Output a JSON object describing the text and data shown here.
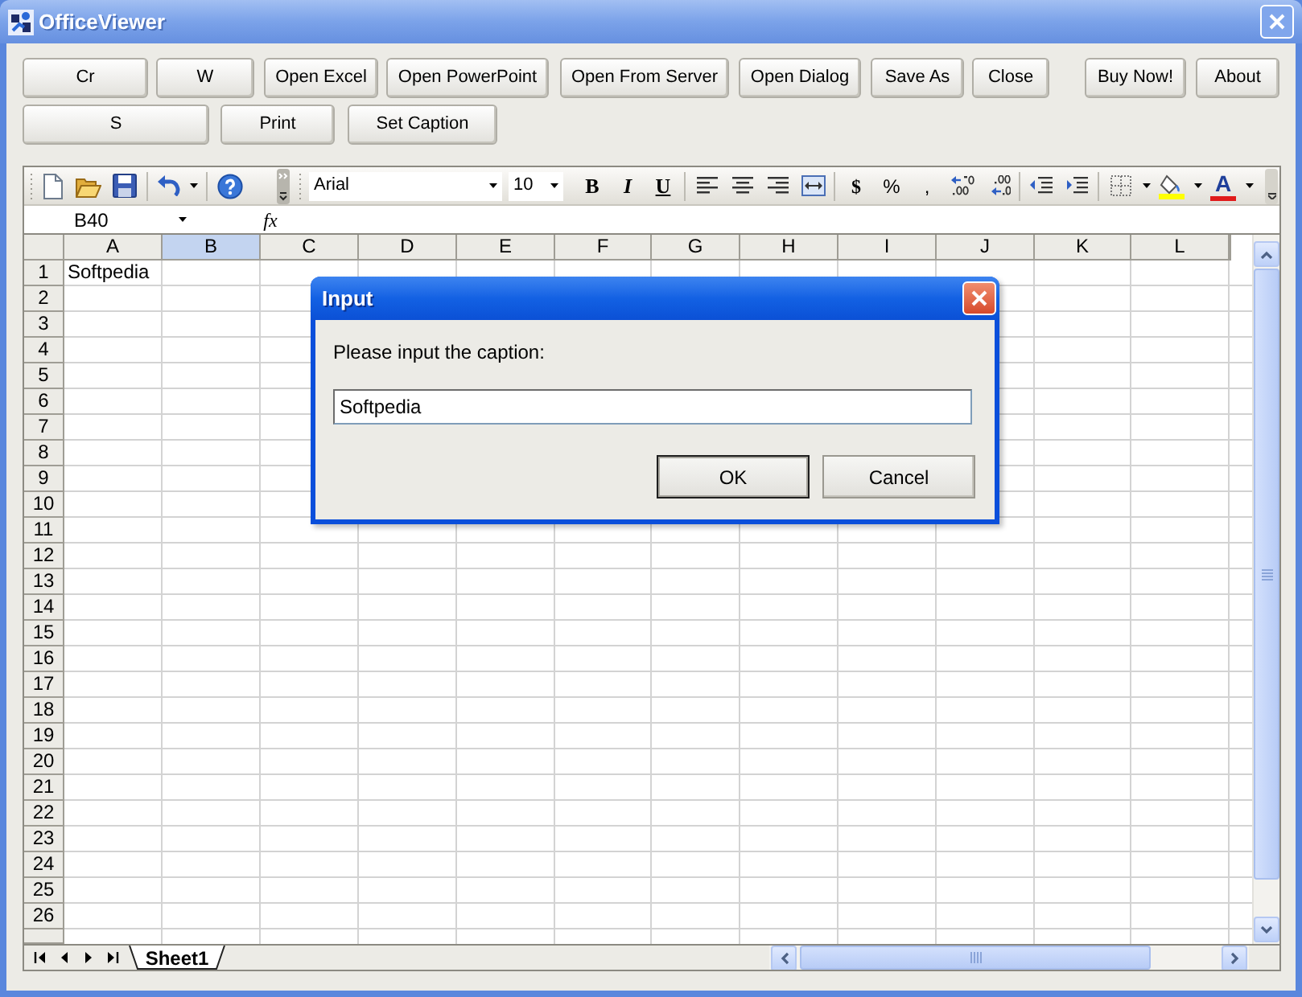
{
  "window": {
    "title": "OfficeViewer"
  },
  "button_rows": [
    {
      "buttons": [
        "Cr",
        "W",
        "Open Excel",
        "Open PowerPoint",
        "Open From Server",
        "Open Dialog",
        "Save As",
        "Close",
        "Buy Now!",
        "About"
      ]
    },
    {
      "buttons": [
        "S",
        "Print",
        "Set Caption"
      ]
    }
  ],
  "toolbar": {
    "font": "Arial",
    "font_size": "10",
    "style_buttons": [
      "B",
      "I",
      "U"
    ],
    "number_buttons": [
      "$",
      "%",
      ","
    ],
    "font_color_glyph": "A"
  },
  "formula_bar": {
    "name_box": "B40",
    "function_label": "fx"
  },
  "sheet": {
    "columns": [
      {
        "label": "A",
        "selected": false
      },
      {
        "label": "B",
        "selected": true
      },
      {
        "label": "C",
        "selected": false
      },
      {
        "label": "D",
        "selected": false
      },
      {
        "label": "E",
        "selected": false
      },
      {
        "label": "F",
        "selected": false
      },
      {
        "label": "G",
        "selected": false
      },
      {
        "label": "H",
        "selected": false
      },
      {
        "label": "I",
        "selected": false
      },
      {
        "label": "J",
        "selected": false
      },
      {
        "label": "K",
        "selected": false
      },
      {
        "label": "L",
        "selected": false
      }
    ],
    "rows": [
      {
        "header": "1",
        "cells": [
          "Softpedia"
        ]
      },
      {
        "header": "2"
      },
      {
        "header": "3"
      },
      {
        "header": "4"
      },
      {
        "header": "5"
      },
      {
        "header": "6"
      },
      {
        "header": "7"
      },
      {
        "header": "8"
      },
      {
        "header": "9"
      },
      {
        "header": "10"
      },
      {
        "header": "11"
      },
      {
        "header": "12"
      },
      {
        "header": "13"
      },
      {
        "header": "14"
      },
      {
        "header": "15"
      },
      {
        "header": "16"
      },
      {
        "header": "17"
      },
      {
        "header": "18"
      },
      {
        "header": "19"
      },
      {
        "header": "20"
      },
      {
        "header": "21"
      },
      {
        "header": "22"
      },
      {
        "header": "23"
      },
      {
        "header": "24"
      },
      {
        "header": "25"
      },
      {
        "header": "26"
      }
    ]
  },
  "sheet_tabs": [
    {
      "label": "Sheet1",
      "selected": true
    }
  ],
  "dialog": {
    "title": "Input",
    "prompt": "Please input the caption:",
    "value": "Softpedia",
    "buttons": [
      {
        "label": "OK",
        "default": true
      },
      {
        "label": "Cancel",
        "default": false
      }
    ]
  }
}
